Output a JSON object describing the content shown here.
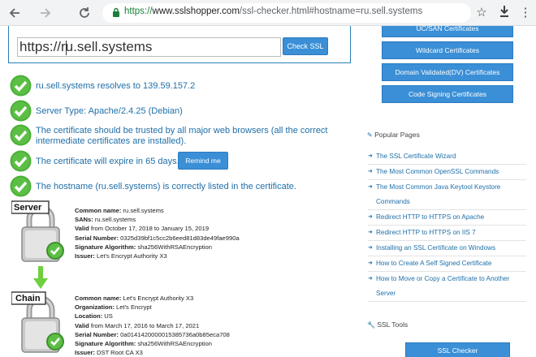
{
  "browser": {
    "url_scheme": "https://",
    "url_host": "www.sslshopper.com",
    "url_path": "/ssl-checker.html#hostname=ru.sell.systems",
    "icons": [
      "back-icon",
      "forward-icon",
      "reload-icon",
      "lock-icon",
      "star-icon",
      "download-icon",
      "menu-icon"
    ]
  },
  "checker": {
    "hostname_value": "https://ru.sell.systems",
    "check_button": "Check SSL"
  },
  "results": [
    "ru.sell.systems resolves to 139.59.157.2",
    "Server Type: Apache/2.4.25 (Debian)",
    "The certificate should be trusted by all major web browsers (all the correct intermediate certificates are installed).",
    "The certificate will expire in 65 days.",
    "The hostname (ru.sell.systems) is correctly listed in the certificate."
  ],
  "remind_button": "Remind me",
  "server_cert": {
    "badge": "Server",
    "fields": [
      {
        "label": "Common name:",
        "value": " ru.sell.systems"
      },
      {
        "label": "SANs:",
        "value": " ru.sell.systems"
      },
      {
        "label": "Valid",
        "value": " from October 17, 2018 to January 15, 2019"
      },
      {
        "label": "Serial Number:",
        "value": " 0325d39bf1c5cc2b6eed81d83de49fae990a"
      },
      {
        "label": "Signature Algorithm:",
        "value": " sha256WithRSAEncryption"
      },
      {
        "label": "Issuer:",
        "value": " Let's Encrypt Authority X3"
      }
    ]
  },
  "chain_cert": {
    "badge": "Chain",
    "fields": [
      {
        "label": "Common name:",
        "value": " Let's Encrypt Authority X3"
      },
      {
        "label": "Organization:",
        "value": " Let's Encrypt"
      },
      {
        "label": "Location:",
        "value": " US"
      },
      {
        "label": "Valid",
        "value": " from March 17, 2016 to March 17, 2021"
      },
      {
        "label": "Serial Number:",
        "value": " 0a0141420000015385736a0b85eca708"
      },
      {
        "label": "Signature Algorithm:",
        "value": " sha256WithRSAEncryption"
      },
      {
        "label": "Issuer:",
        "value": " DST Root CA X3"
      }
    ]
  },
  "sidebar": {
    "buttons": [
      "UC/SAN Certificates",
      "Wildcard Certificates",
      "Domain Validated(DV) Certificates",
      "Code Signing Certificates"
    ],
    "popular_heading": "Popular Pages",
    "popular_links": [
      "The SSL Certificate Wizard",
      "The Most Common OpenSSL Commands",
      "The Most Common Java Keytool Keystore Commands",
      "Redirect HTTP to HTTPS on Apache",
      "Redirect HTTP to HTTPS on IIS 7",
      "Installing an SSL Certificate on Windows",
      "How to Create A Self Signed Certificate",
      "How to Move or Copy a Certificate to Another Server"
    ],
    "tools_heading": "SSL Tools",
    "tools_button": "SSL Checker"
  },
  "colors": {
    "accent": "#3a8fd6",
    "link": "#1f6fa8",
    "ok_green": "#4caf3a",
    "url_green": "#188038"
  }
}
